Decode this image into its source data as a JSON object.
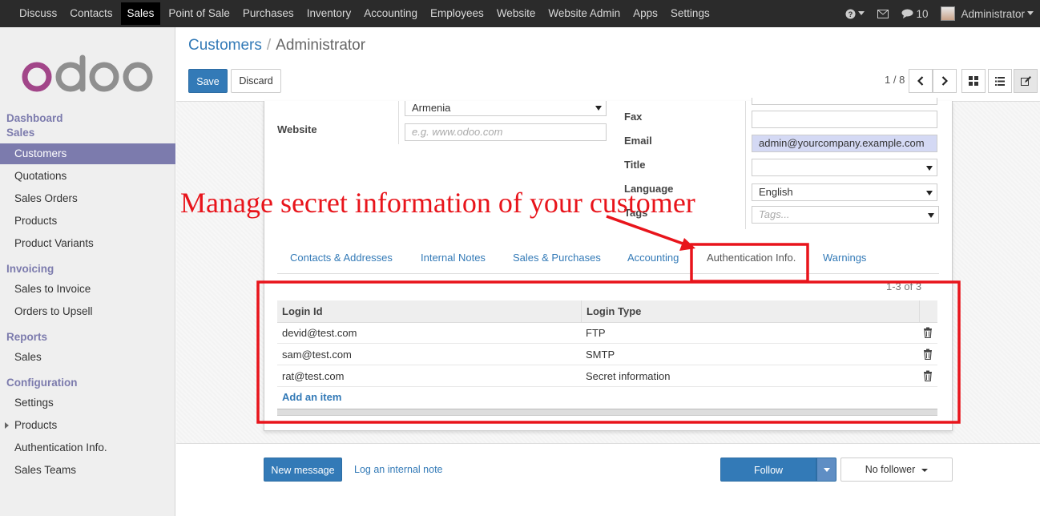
{
  "topbar": {
    "menu": [
      "Discuss",
      "Contacts",
      "Sales",
      "Point of Sale",
      "Purchases",
      "Inventory",
      "Accounting",
      "Employees",
      "Website",
      "Website Admin",
      "Apps",
      "Settings"
    ],
    "active_menu": "Sales",
    "message_count": "10",
    "user": "Administrator"
  },
  "sidebar": {
    "logo": "odoo",
    "sections": {
      "dashboard": "Dashboard",
      "sales": "Sales",
      "invoicing": "Invoicing",
      "reports": "Reports",
      "configuration": "Configuration"
    },
    "sales_items": [
      "Customers",
      "Quotations",
      "Sales Orders",
      "Products",
      "Product Variants"
    ],
    "invoicing_items": [
      "Sales to Invoice",
      "Orders to Upsell"
    ],
    "reports_items": [
      "Sales"
    ],
    "configuration_items": [
      "Settings",
      "Products",
      "Authentication Info.",
      "Sales Teams"
    ]
  },
  "breadcrumb": {
    "parent": "Customers",
    "separator": "/",
    "current": "Administrator"
  },
  "actions": {
    "save": "Save",
    "discard": "Discard"
  },
  "pager": {
    "text": "1 / 8"
  },
  "form": {
    "country_value": "Armenia",
    "website_label": "Website",
    "website_placeholder": "e.g. www.odoo.com",
    "fax_label": "Fax",
    "email_label": "Email",
    "email_value": "admin@yourcompany.example.com",
    "title_label": "Title",
    "language_label": "Language",
    "language_value": "English",
    "tags_label": "Tags",
    "tags_placeholder": "Tags..."
  },
  "annotation": "Manage secret information of your customer",
  "tabs": [
    "Contacts & Addresses",
    "Internal Notes",
    "Sales & Purchases",
    "Accounting",
    "Authentication Info.",
    "Warnings"
  ],
  "active_tab": "Authentication Info.",
  "auth_table": {
    "pager": "1-3 of 3",
    "columns": [
      "Login Id",
      "Login Type"
    ],
    "rows": [
      [
        "devid@test.com",
        "FTP"
      ],
      [
        "sam@test.com",
        "SMTP"
      ],
      [
        "rat@test.com",
        "Secret information"
      ]
    ],
    "add_item": "Add an item"
  },
  "chatter": {
    "new_message": "New message",
    "log_note": "Log an internal note",
    "follow": "Follow",
    "followers": "No follower"
  },
  "colors": {
    "accent": "#337ab7",
    "sidebar_active": "#7c7bad",
    "annotation": "#e8141b"
  }
}
